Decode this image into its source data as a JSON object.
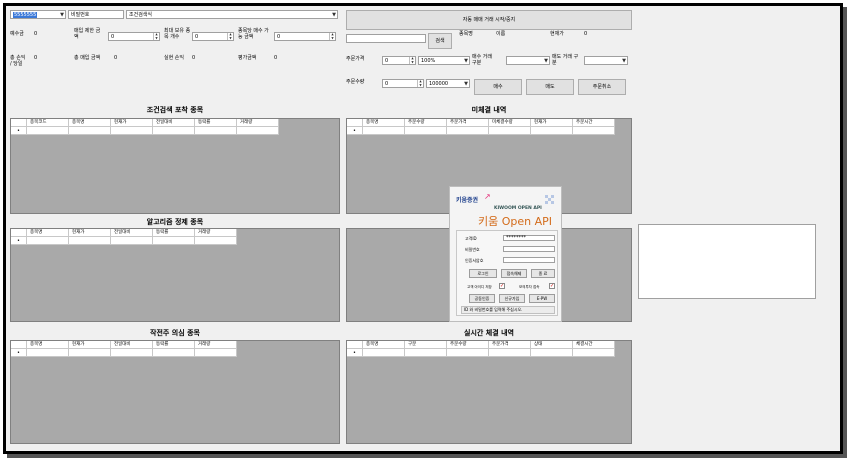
{
  "top": {
    "account_select": "5555555",
    "password_placeholder": "비밀번호",
    "condition_select": "조건검색식",
    "auto_trade_button": "자동 매매 거래 시작/중지"
  },
  "left_fields": {
    "deposit_label": "예수금",
    "deposit_value": "0",
    "buy_limit_label": "매입 제한 금액",
    "buy_limit_value": "0",
    "max_stocks_label": "최대 보유 종목 개수",
    "max_stocks_value": "0",
    "per_stock_label": "종목당 매수 가능 금액",
    "per_stock_value": "0",
    "total_profit_label": "총 손익 / 당일",
    "total_profit_value": "0",
    "total_buy_label": "총 매입 금액",
    "total_buy_value": "0",
    "realized_label": "실현 손익",
    "realized_value": "0",
    "eval_label": "평가금액",
    "eval_value": "0"
  },
  "order": {
    "search_button": "검색",
    "stock_name_label": "종목명",
    "stock_name_value": "이름",
    "current_price_label": "현재가",
    "current_price_value": "0",
    "order_price_label": "주문가격",
    "order_price_value": "0",
    "percent_value": "100%",
    "buy_type_label": "매수 거래 구분",
    "sell_type_label": "매도 거래 구분",
    "order_qty_label": "주문수량",
    "order_qty_value": "0",
    "amount_value": "100000",
    "buy_button": "매수",
    "sell_button": "매도",
    "cancel_button": "주문취소"
  },
  "grids": {
    "condition": {
      "title": "조건검색 포착 종목",
      "columns": [
        "종목코드",
        "종목명",
        "현재가",
        "전일대비",
        "등락률",
        "거래량"
      ]
    },
    "unfilled": {
      "title": "미체결 내역",
      "columns": [
        "종목명",
        "주문수량",
        "주문가격",
        "미체결수량",
        "현재가",
        "주문시간"
      ]
    },
    "algo": {
      "title": "알고리즘 정제 종목",
      "columns": [
        "종목명",
        "현재가",
        "전일대비",
        "등락률",
        "거래량"
      ]
    },
    "suspect": {
      "title": "작전주 의심 종목",
      "columns": [
        "종목명",
        "현재가",
        "전일대비",
        "등락률",
        "거래량"
      ]
    },
    "realtime": {
      "title": "실시간 체결 내역",
      "columns": [
        "종목명",
        "구분",
        "주문수량",
        "주문가격",
        "상태",
        "체결시간"
      ]
    },
    "row_marker": "•"
  },
  "login": {
    "brand": "키움증권",
    "subtitle": "KIWOOM OPEN API",
    "title": "키움 Open API",
    "id_label": "고객ID",
    "id_value": "********",
    "pw_label": "비밀번호",
    "cert_label": "인증서암호",
    "login_button": "로그인",
    "cert_button": "접속해제",
    "exit_button": "종 료",
    "save_id_label": "고객 아이디 저장",
    "mock_label": "모의투자 접속",
    "check_mark": "✓",
    "cert_mgmt_button": "공동인증",
    "signup_button": "신규가입",
    "site_button": "E-PW",
    "status": "ID 와 비밀번호를 입력해 주십시오."
  }
}
